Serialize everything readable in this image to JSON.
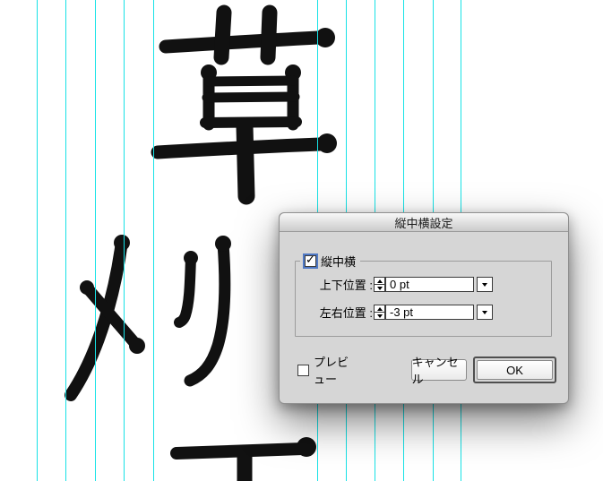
{
  "canvas": {
    "background_color": "#ffffff",
    "guide_color": "#17e2e6",
    "guide_lines_x": [
      41,
      73,
      106,
      138,
      171,
      354,
      386,
      418,
      450,
      483,
      514
    ],
    "glyph_color": "#111111",
    "glyphs": [
      {
        "name": "kusa",
        "char": "草"
      },
      {
        "name": "me",
        "char": "メ"
      },
      {
        "name": "ri",
        "char": "リ"
      },
      {
        "name": "partial-bottom",
        "char": "",
        "note": "top bar and stem of a character cropped by the bottom edge"
      }
    ]
  },
  "dialog": {
    "title": "縦中横設定",
    "group": {
      "label": "縦中横",
      "checkbox_checked": true,
      "check_glyph": "✓"
    },
    "fields": [
      {
        "label": "上下位置 :",
        "value": "0 pt"
      },
      {
        "label": "左右位置 :",
        "value": "-3 pt"
      }
    ],
    "preview": {
      "label": "プレビュー",
      "checked": false
    },
    "buttons": {
      "cancel": "キャンセル",
      "ok": "OK"
    }
  }
}
